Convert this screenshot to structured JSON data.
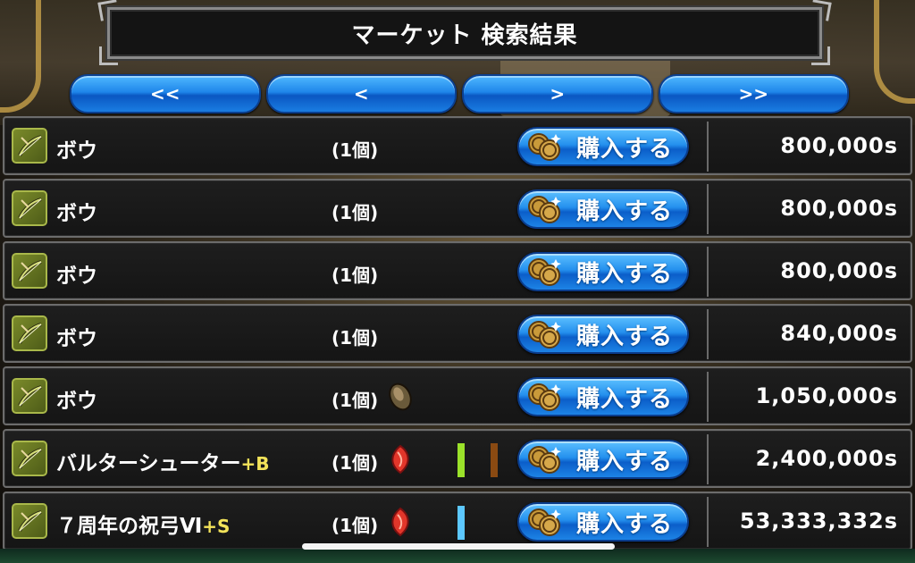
{
  "title": "マーケット 検索結果",
  "nav": {
    "first": "<<",
    "prev": "<",
    "next": ">",
    "last": ">>"
  },
  "buy_label": "購入する",
  "rows": [
    {
      "name": "ボウ",
      "plus": "",
      "qty": "(1個)",
      "price": "800,000s",
      "gem": null,
      "bars": []
    },
    {
      "name": "ボウ",
      "plus": "",
      "qty": "(1個)",
      "price": "800,000s",
      "gem": null,
      "bars": []
    },
    {
      "name": "ボウ",
      "plus": "",
      "qty": "(1個)",
      "price": "800,000s",
      "gem": null,
      "bars": []
    },
    {
      "name": "ボウ",
      "plus": "",
      "qty": "(1個)",
      "price": "840,000s",
      "gem": null,
      "bars": []
    },
    {
      "name": "ボウ",
      "plus": "",
      "qty": "(1個)",
      "price": "1,050,000s",
      "gem": "seed-gem-icon",
      "bars": []
    },
    {
      "name": "バルターシューター",
      "plus": "+B",
      "qty": "(1個)",
      "price": "2,400,000s",
      "gem": "red-gem-icon",
      "bars": [
        "#9be22a",
        "#8a4a12"
      ]
    },
    {
      "name": "７周年の祝弓Ⅵ",
      "plus": "+S",
      "qty": "(1個)",
      "price": "53,333,332s",
      "gem": "red-gem-icon",
      "bars": [
        "#5cc8ff"
      ]
    }
  ],
  "colors": {
    "button_blue": "#1f86ea",
    "plus_yellow": "#f3e35a"
  }
}
